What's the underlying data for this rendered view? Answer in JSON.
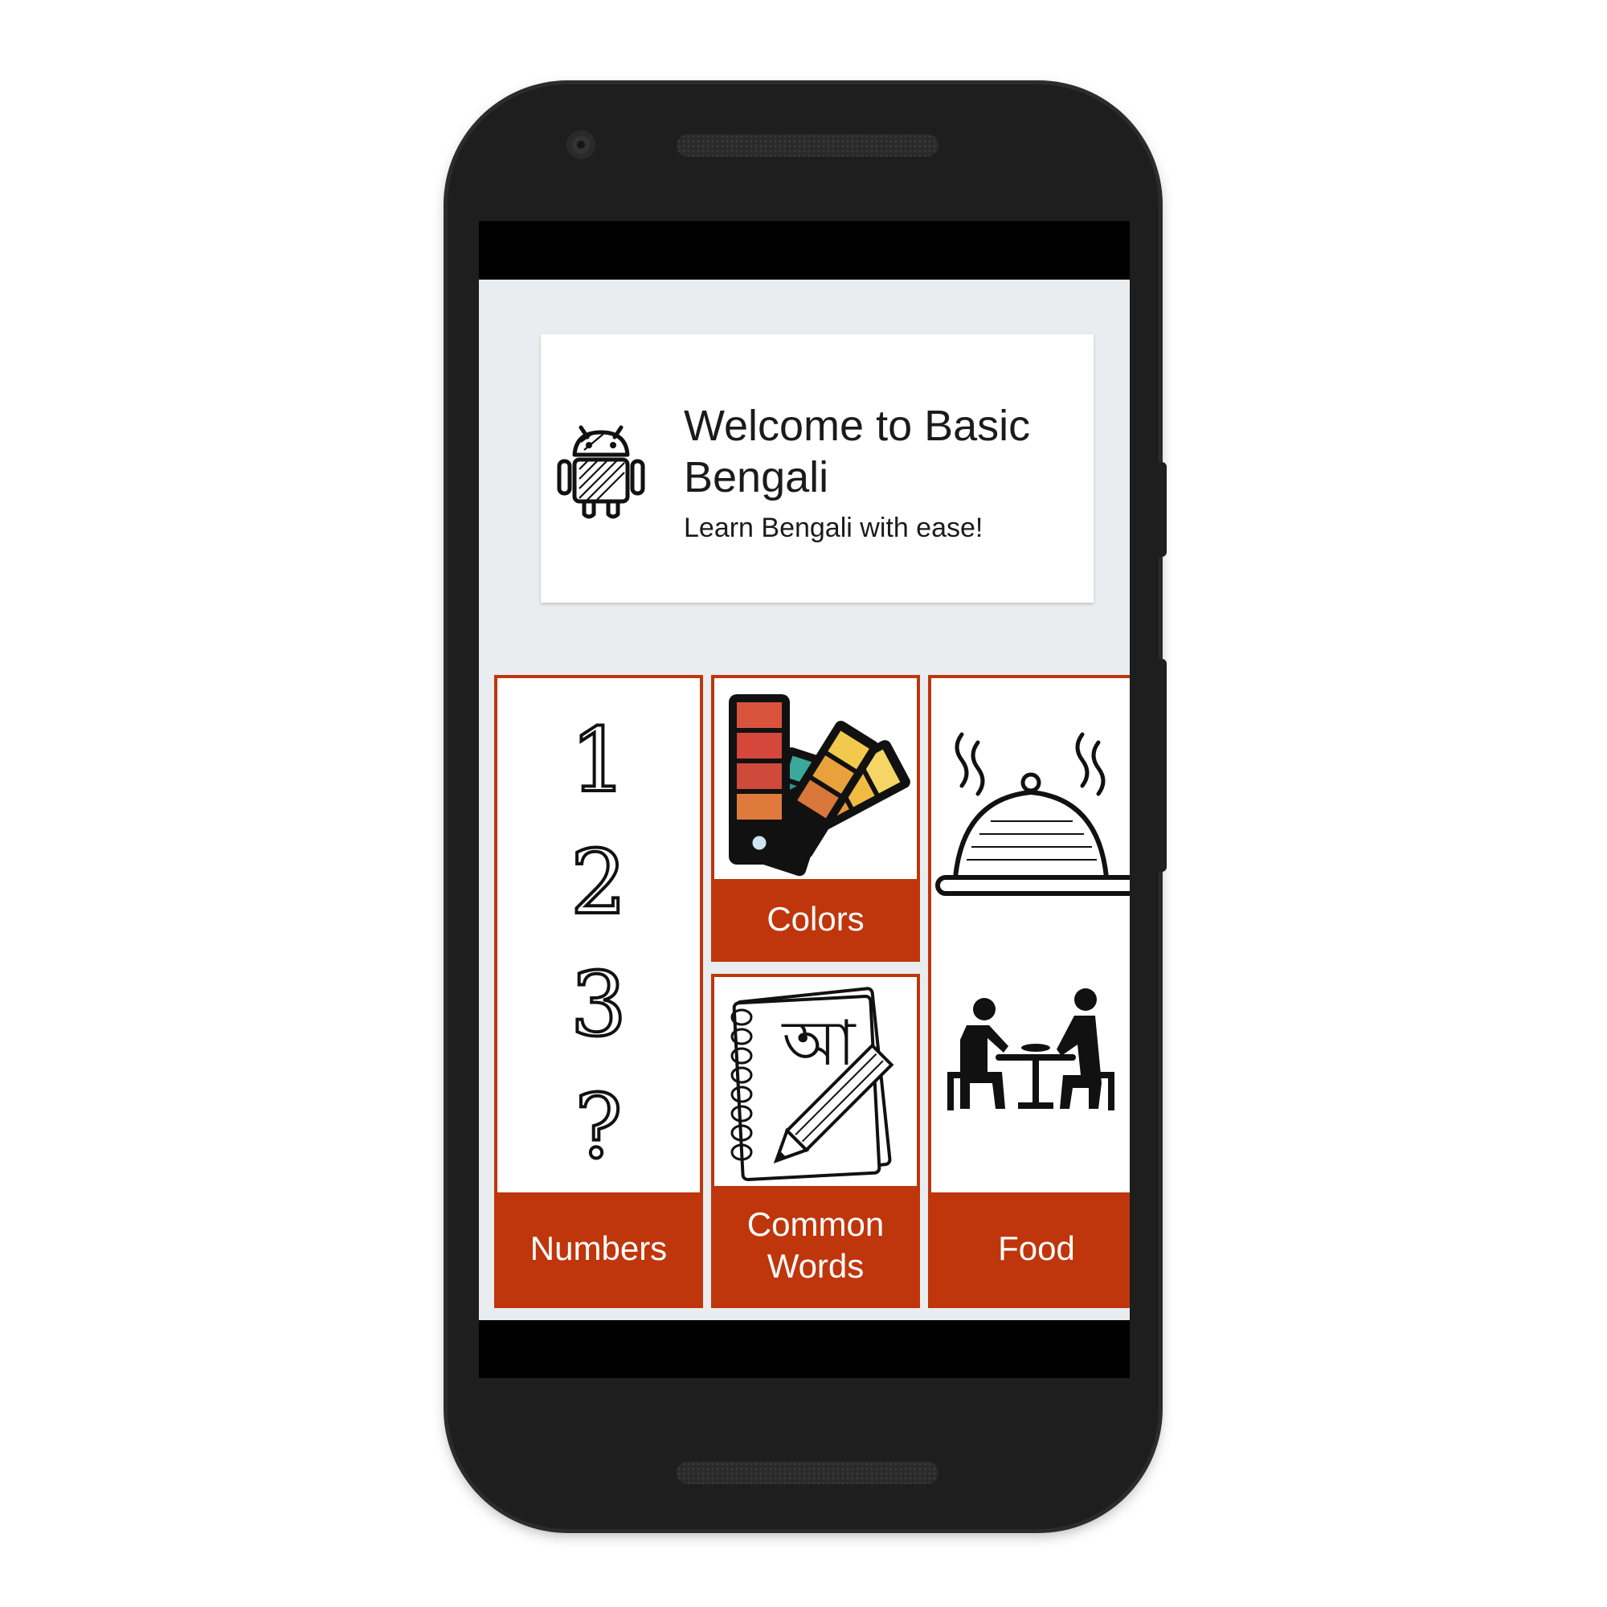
{
  "welcome": {
    "title": "Welcome to Basic Bengali",
    "subtitle": "Learn Bengali with ease!",
    "icon": "android-robot-icon"
  },
  "categories": [
    {
      "id": "numbers",
      "label": "Numbers",
      "icon": "numbers-123-icon",
      "digits": [
        "1",
        "2",
        "3",
        "?"
      ]
    },
    {
      "id": "colors",
      "label": "Colors",
      "icon": "color-swatch-icon"
    },
    {
      "id": "common-words",
      "label": "Common\nWords",
      "icon": "notebook-pencil-icon",
      "glyph": "আ"
    },
    {
      "id": "food",
      "label": "Food",
      "icon": "food-cloche-dining-icon"
    }
  ],
  "colors": {
    "accent": "#bf360c",
    "background": "#e9edf0",
    "card": "#ffffff"
  }
}
